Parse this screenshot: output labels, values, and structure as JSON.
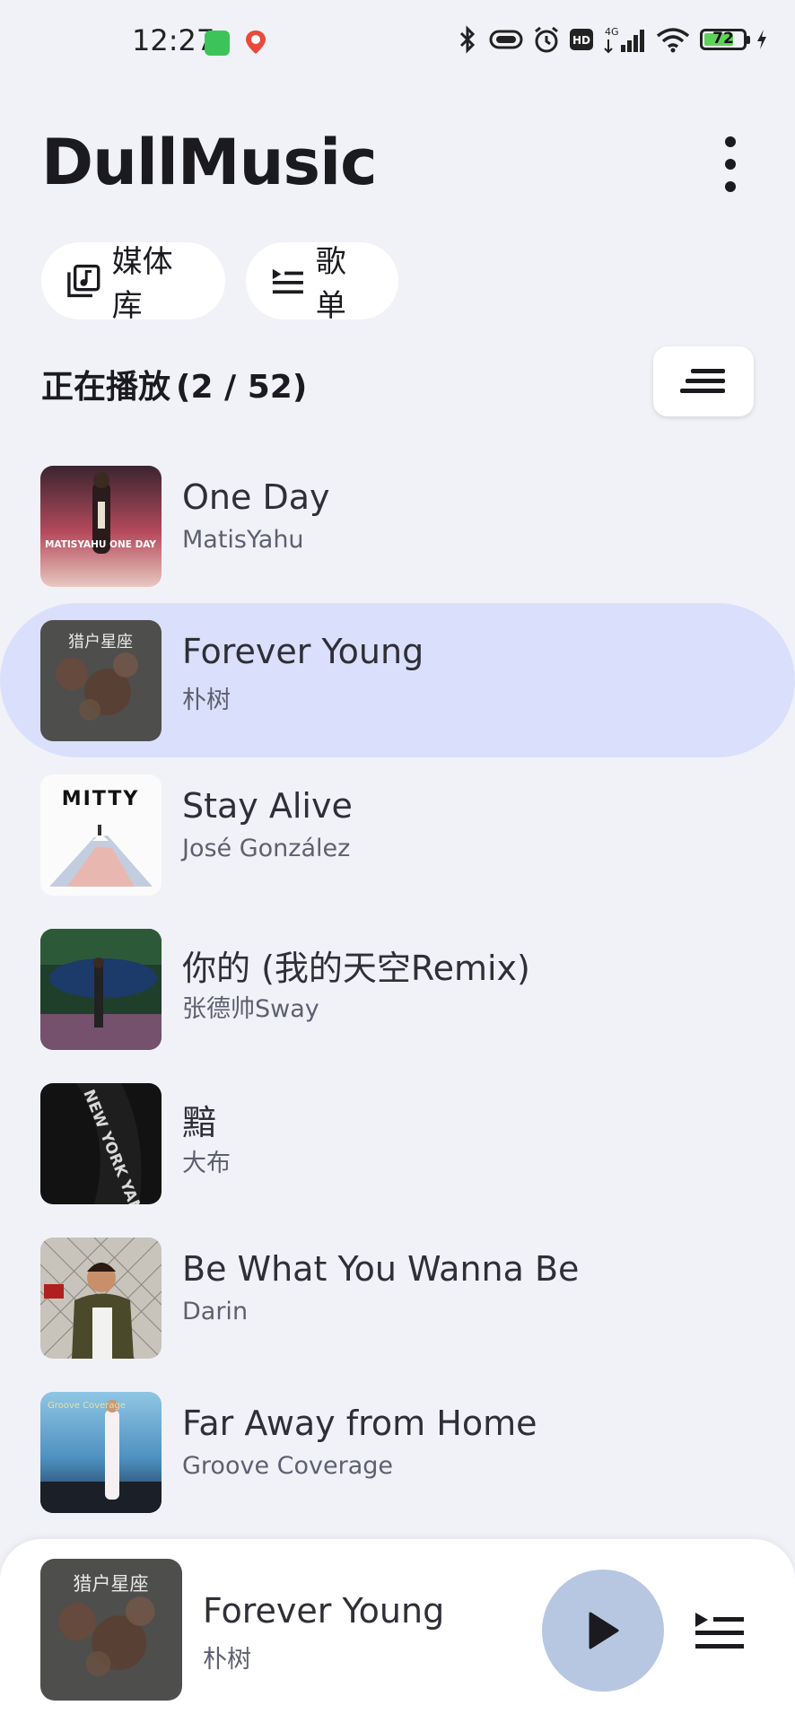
{
  "status_bar": {
    "time": "12:27",
    "battery": "72",
    "network": "4G"
  },
  "header": {
    "title": "DullMusic"
  },
  "chips": {
    "library": "媒体库",
    "playlists": "歌单"
  },
  "now_playing": {
    "label": "正在播放",
    "count": "(2 / 52)"
  },
  "songs": [
    {
      "title": "One Day",
      "artist": "MatisYahu",
      "cover_text": "MATISYAHU ONE DAY"
    },
    {
      "title": "Forever Young",
      "artist": "朴树",
      "cover_text": "猎户星座"
    },
    {
      "title": "Stay Alive",
      "artist": "José González",
      "cover_text": "MITTY"
    },
    {
      "title": "你的 (我的天空Remix)",
      "artist": "张德帅Sway",
      "cover_text": ""
    },
    {
      "title": "黯",
      "artist": "大布",
      "cover_text": "NEW YORK YANKEES"
    },
    {
      "title": "Be What You Wanna Be",
      "artist": "Darin",
      "cover_text": ""
    },
    {
      "title": "Far Away from Home",
      "artist": "Groove Coverage",
      "cover_text": "Groove Coverage"
    }
  ],
  "player": {
    "title": "Forever Young",
    "artist": "朴树",
    "cover_text": "猎户星座"
  },
  "colors": {
    "background": "#f1f2f8",
    "active_row": "#dae0fb",
    "play_button": "#b7c7e2"
  }
}
